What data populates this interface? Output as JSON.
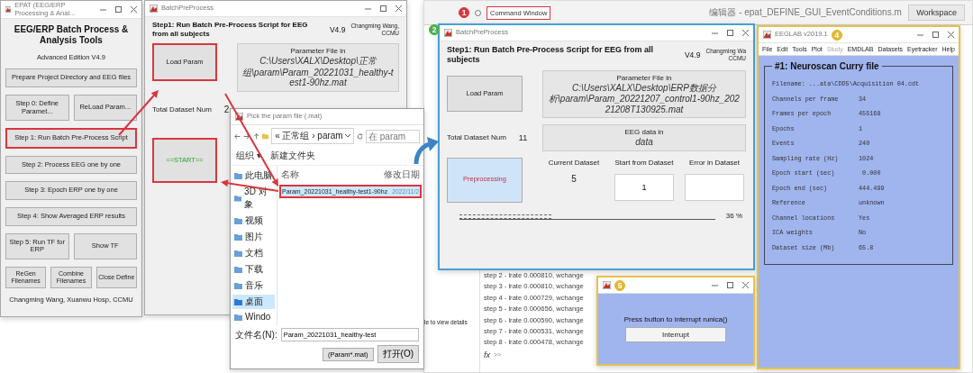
{
  "epat_window": {
    "title": "EPAT (EEG/ERP Processing & Anal...",
    "heading": "EEG/ERP Batch Process & Analysis Tools",
    "edition": "Advanced Edition  V4.9",
    "button_rows": [
      [
        {
          "label": "Prepare Project Directory and EEG files",
          "highlighted": false
        }
      ],
      [
        {
          "label": "Step 0: Define Paramet...",
          "highlighted": false
        },
        {
          "label": "ReLoad Param...",
          "highlighted": false
        }
      ],
      [
        {
          "label": "Step 1: Run Batch Pre-Process Script",
          "highlighted": true
        }
      ],
      [
        {
          "label": "Step 2: Process EEG one by one",
          "highlighted": false
        }
      ],
      [
        {
          "label": "Step 3: Epoch ERP one by one",
          "highlighted": false
        }
      ],
      [
        {
          "label": "Step 4: Show Averaged ERP results",
          "highlighted": false
        }
      ],
      [
        {
          "label": "Step 5: Run TF for ERP",
          "highlighted": false
        },
        {
          "label": "Show TF",
          "highlighted": false
        }
      ],
      [
        {
          "label": "ReGen Filenames",
          "highlighted": false
        },
        {
          "label": "Combine Filenames",
          "highlighted": false
        },
        {
          "label": "Close Define",
          "highlighted": false
        }
      ]
    ],
    "credit": "Changming Wang, Xuanwu Hosp, CCMU"
  },
  "batch_window_before": {
    "title": "BatchPreProcess",
    "heading": "Step1: Run Batch Pre-Process Script for EEG from all subjects",
    "version": "V4.9",
    "credit": [
      "Changming Wang,",
      "CCMU"
    ],
    "load_button": {
      "label": "Load Param",
      "highlighted": true
    },
    "param_box": {
      "caption": "Parameter File in",
      "lines": [
        "C:\\Users\\XALX\\Desktop\\正常",
        "组\\param\\Param_20221031_healthy-test1-90hz.mat"
      ]
    },
    "dataset_count": {
      "label": "Total Dataset Num",
      "value": "2"
    },
    "start_button": {
      "label": "==START==",
      "highlighted": true
    }
  },
  "file_dialog": {
    "title": "Pick the param file (.mat)",
    "path": "« 正常组 › param",
    "search_placeholder": "在 param",
    "toolbar": [
      "组织 ▾",
      "新建文件夹"
    ],
    "sidebar": [
      {
        "label": "此电脑",
        "selected": false
      },
      {
        "label": "3D 对象",
        "selected": false
      },
      {
        "label": "视频",
        "selected": false
      },
      {
        "label": "图片",
        "selected": false
      },
      {
        "label": "文档",
        "selected": false
      },
      {
        "label": "下载",
        "selected": false
      },
      {
        "label": "音乐",
        "selected": false
      },
      {
        "label": "桌面",
        "selected": true
      },
      {
        "label": "Windo",
        "selected": false
      }
    ],
    "columns": [
      "名称",
      "修改日期"
    ],
    "files": [
      {
        "name": "Param_20221031_healthy-test1-90hz",
        "modified": "2022/11/2",
        "selected": true,
        "highlighted": true
      }
    ],
    "filename_label": "文件名(N):",
    "filename": "Param_20221031_healthy-test",
    "filter": "(Param*.mat)",
    "open_button": "打开(O)"
  },
  "callouts": [
    {
      "label": "1",
      "color": "#d9363e"
    },
    {
      "label": "2",
      "color": "#4caf50"
    },
    {
      "label": "4",
      "color": "#e0b830"
    },
    {
      "label": "5",
      "color": "#e0b830"
    }
  ],
  "matlab": {
    "command_window": {
      "label": "Command Window",
      "highlighted": true
    },
    "editor_tab": "编辑器 - epat_DEFINE_GUI_EventConditions.m",
    "workspace": "Workspace",
    "side_note": "le to view details",
    "command_lines": [
      "step 2 - lrate 0.000810, wchange",
      "step 3 - lrate 0.000810, wchange",
      "step 4 - lrate 0.000729, wchange",
      "step 5 - lrate 0.000656, wchange",
      "step 6 - lrate 0.000590, wchange",
      "step 7 - lrate 0.000531, wchange",
      "step 8 - lrate 0.000478, wchange"
    ],
    "prompt": {
      "symbol": "fx",
      "text": ">>"
    }
  },
  "batch_window_running": {
    "title": "BatchPreProcess",
    "heading": "Step1: Run Batch Pre-Process Script for EEG from all subjects",
    "version": "V4.9",
    "credit": [
      "Changming Wa",
      "CCMU"
    ],
    "load_button": {
      "label": "Load Param",
      "highlighted": false
    },
    "param_box": {
      "caption": "Parameter File in",
      "lines": [
        "C:\\Users\\XALX\\Desktop\\ERP数据分",
        "析\\param\\Param_20221207_control1-90hz_20221208T130925.mat"
      ]
    },
    "dataset_count": {
      "label": "Total Dataset Num",
      "value": "11"
    },
    "data_box": {
      "caption": "EEG data in",
      "lines": [
        "data"
      ]
    },
    "run_button": {
      "label": "Preprocessing",
      "active": true
    },
    "current": {
      "label": "Current Dataset",
      "value": "5"
    },
    "start_from": {
      "label": "Start from Dataset",
      "value": "1"
    },
    "error_in": {
      "label": "Error in Dataset"
    },
    "progress": {
      "level": 0.36,
      "reading": "36 %"
    }
  },
  "eeglab": {
    "title": "EEGLAB v2019.1",
    "menu": [
      {
        "label": "File",
        "disabled": false
      },
      {
        "label": "Edit",
        "disabled": false
      },
      {
        "label": "Tools",
        "disabled": false
      },
      {
        "label": "Plot",
        "disabled": false
      },
      {
        "label": "Study",
        "disabled": true
      },
      {
        "label": "EMDLAB",
        "disabled": false
      },
      {
        "label": "Datasets",
        "disabled": false
      },
      {
        "label": "Eyetracker",
        "disabled": false
      },
      {
        "label": "Help",
        "disabled": false
      }
    ],
    "panel_title": "#1: Neuroscan Curry file",
    "filename": "Filename: ...ata\\CDD5\\Acquisition 04.cdt",
    "rows": [
      {
        "label": "Channels per frame",
        "value": "34"
      },
      {
        "label": "Frames per epoch",
        "value": "455168"
      },
      {
        "label": "Epochs",
        "value": "1"
      },
      {
        "label": "Events",
        "value": "240"
      },
      {
        "label": "Sampling rate (Hz)",
        "value": "1024"
      },
      {
        "label": "Epoch start (sec)",
        "value": " 0.000"
      },
      {
        "label": "Epoch end (sec)",
        "value": "444.499"
      },
      {
        "label": "Reference",
        "value": "unknown"
      },
      {
        "label": "Channel locations",
        "value": "Yes"
      },
      {
        "label": "ICA weights",
        "value": "No"
      },
      {
        "label": "Dataset size (Mb)",
        "value": "65.8"
      }
    ]
  },
  "interrupt_window": {
    "message": "Press button to interrupt runica()",
    "button": "Interrupt"
  }
}
